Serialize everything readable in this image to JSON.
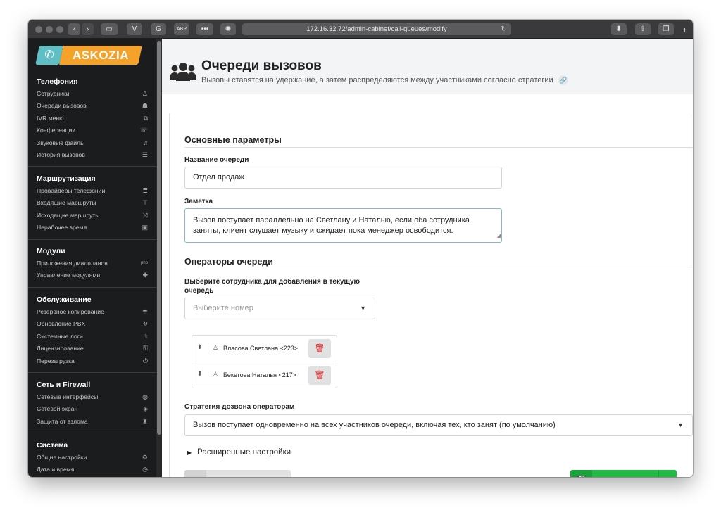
{
  "browser": {
    "url": "172.16.32.72/admin-cabinet/call-queues/modify",
    "tab_buttons": [
      "V",
      "G",
      "ABP",
      "•••"
    ]
  },
  "logo": {
    "text": "ASKOZIA"
  },
  "sidebar": {
    "sections": [
      {
        "title": "Телефония",
        "items": [
          {
            "label": "Сотрудники",
            "icon": "user-icon"
          },
          {
            "label": "Очереди вызовов",
            "icon": "users-icon"
          },
          {
            "label": "IVR меню",
            "icon": "sitemap-icon"
          },
          {
            "label": "Конференции",
            "icon": "phone-volume-icon"
          },
          {
            "label": "Звуковые файлы",
            "icon": "headphones-icon"
          },
          {
            "label": "История вызовов",
            "icon": "list-icon"
          }
        ]
      },
      {
        "title": "Маршрутизация",
        "items": [
          {
            "label": "Провайдеры телефонии",
            "icon": "server-icon"
          },
          {
            "label": "Входящие маршруты",
            "icon": "signs-icon"
          },
          {
            "label": "Исходящие маршруты",
            "icon": "random-icon"
          },
          {
            "label": "Нерабочее время",
            "icon": "calendar-icon"
          }
        ]
      },
      {
        "title": "Модули",
        "items": [
          {
            "label": "Приложения диалпланов",
            "icon": "php-icon"
          },
          {
            "label": "Управление модулями",
            "icon": "puzzle-icon"
          }
        ]
      },
      {
        "title": "Обслуживание",
        "items": [
          {
            "label": "Резервное копирование",
            "icon": "umbrella-icon"
          },
          {
            "label": "Обновление PBX",
            "icon": "sync-icon"
          },
          {
            "label": "Системные логи",
            "icon": "stethoscope-icon"
          },
          {
            "label": "Лицензирование",
            "icon": "key-icon"
          },
          {
            "label": "Перезагрузка",
            "icon": "power-icon"
          }
        ]
      },
      {
        "title": "Сеть и Firewall",
        "items": [
          {
            "label": "Сетевые интерфейсы",
            "icon": "globe-icon"
          },
          {
            "label": "Сетевой экран",
            "icon": "shield-icon"
          },
          {
            "label": "Защита от взлома",
            "icon": "user-secret-icon"
          }
        ]
      },
      {
        "title": "Система",
        "items": [
          {
            "label": "Общие настройки",
            "icon": "cogs-icon"
          },
          {
            "label": "Дата и время",
            "icon": "clock-icon"
          }
        ]
      }
    ]
  },
  "header": {
    "title": "Очереди вызовов",
    "subtitle": "Вызовы ставятся на удержание, а затем распределяются между участниками согласно стратегии"
  },
  "form": {
    "basic_section": "Основные параметры",
    "name_label": "Название очереди",
    "name_value": "Отдел продаж",
    "note_label": "Заметка",
    "note_value": "Вызов поступает параллельно на Светлану и Наталью, если оба сотрудника заняты, клиент слушает музыку и ожидает пока менеджер освободится.",
    "operators_section": "Операторы очереди",
    "select_label": "Выберите сотрудника для добавления в текущую очередь",
    "select_placeholder": "Выберите номер",
    "operators": [
      {
        "name": "Власова Светлана <223>"
      },
      {
        "name": "Бекетова Наталья <217>"
      }
    ],
    "strategy_label": "Стратегия дозвона операторам",
    "strategy_value": "Вызов поступает одновременно на всех участников очереди, включая тех, кто занят (по умолчанию)",
    "advanced_label": "Расширенные настройки",
    "back_button": "Назад к списку",
    "save_button": "Сохранить"
  },
  "colors": {
    "sidebar_bg": "#1b1c1d",
    "save_green": "#21ba45",
    "delete_red": "#db2828",
    "logo_orange": "#f4a229",
    "logo_teal": "#5fbfc4"
  }
}
